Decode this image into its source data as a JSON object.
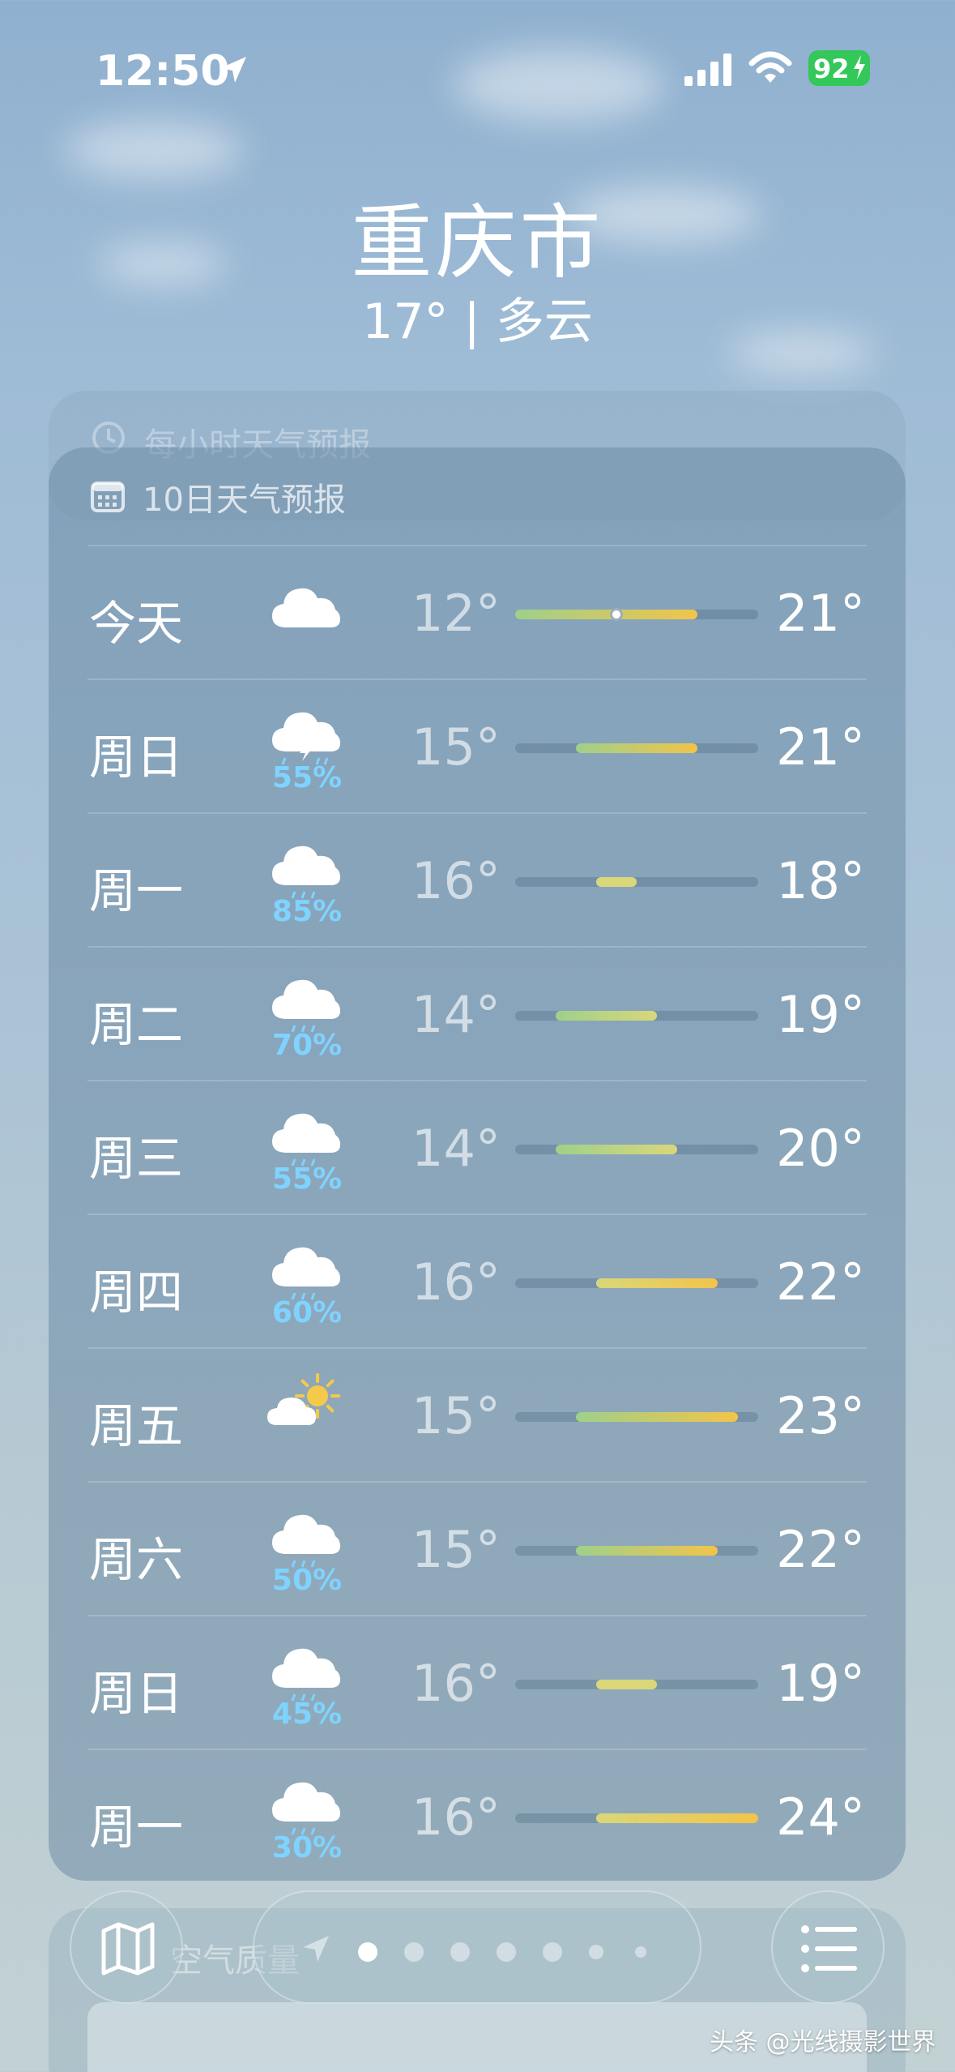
{
  "status_bar": {
    "time": "12:50",
    "battery": "92"
  },
  "header": {
    "city": "重庆市",
    "condition": "17° | 多云"
  },
  "hourly_card": {
    "title": "每小时天气预报"
  },
  "forecast_card": {
    "title": "10日天气预报",
    "scale_min": 12,
    "scale_max": 24,
    "current_temp": 17,
    "rows": [
      {
        "day": "今天",
        "icon": "cloud-icon",
        "pop": "",
        "low": "12°",
        "high": "21°",
        "low_value": 12,
        "high_value": 21
      },
      {
        "day": "周日",
        "icon": "thunderstorm-icon",
        "pop": "55%",
        "low": "15°",
        "high": "21°",
        "low_value": 15,
        "high_value": 21
      },
      {
        "day": "周一",
        "icon": "rain-cloud-icon",
        "pop": "85%",
        "low": "16°",
        "high": "18°",
        "low_value": 16,
        "high_value": 18
      },
      {
        "day": "周二",
        "icon": "rain-cloud-icon",
        "pop": "70%",
        "low": "14°",
        "high": "19°",
        "low_value": 14,
        "high_value": 19
      },
      {
        "day": "周三",
        "icon": "rain-cloud-icon",
        "pop": "55%",
        "low": "14°",
        "high": "20°",
        "low_value": 14,
        "high_value": 20
      },
      {
        "day": "周四",
        "icon": "rain-cloud-icon",
        "pop": "60%",
        "low": "16°",
        "high": "22°",
        "low_value": 16,
        "high_value": 22
      },
      {
        "day": "周五",
        "icon": "partly-sunny-icon",
        "pop": "",
        "low": "15°",
        "high": "23°",
        "low_value": 15,
        "high_value": 23
      },
      {
        "day": "周六",
        "icon": "rain-cloud-icon",
        "pop": "50%",
        "low": "15°",
        "high": "22°",
        "low_value": 15,
        "high_value": 22
      },
      {
        "day": "周日",
        "icon": "rain-cloud-icon",
        "pop": "45%",
        "low": "16°",
        "high": "19°",
        "low_value": 16,
        "high_value": 19
      },
      {
        "day": "周一",
        "icon": "rain-cloud-icon",
        "pop": "30%",
        "low": "16°",
        "high": "24°",
        "low_value": 16,
        "high_value": 24
      }
    ]
  },
  "air_quality_card": {
    "title": "空气质量"
  },
  "bottom_bar": {
    "page_count": 7,
    "active_page": 0
  },
  "watermark": "头条 @光线摄影世界",
  "colors": {
    "pop_blue": "#7fd3ff",
    "cool": "#9fd08a",
    "mild": "#d9d77a",
    "warm": "#f2c44a",
    "battery_green": "#34c759"
  }
}
